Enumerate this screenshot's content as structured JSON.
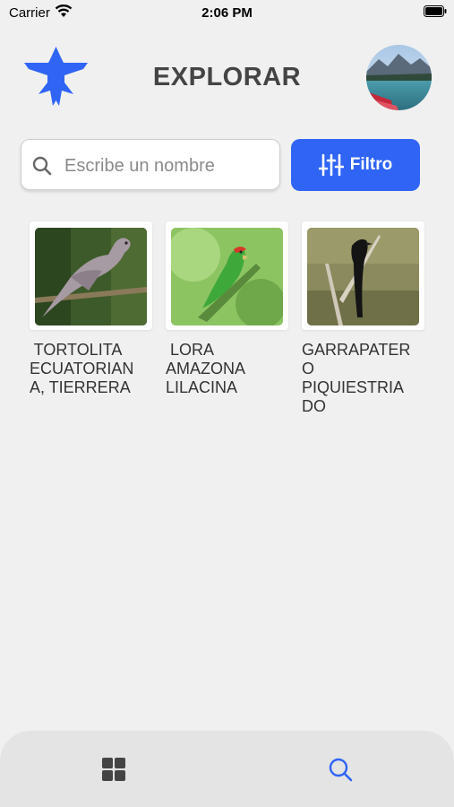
{
  "status_bar": {
    "carrier": "Carrier",
    "time": "2:06 PM"
  },
  "header": {
    "title": "EXPLORAR",
    "logo_icon": "bird-logo-icon",
    "avatar_icon": "lake-mountain-avatar"
  },
  "search": {
    "placeholder": "Escribe un nombre",
    "value": ""
  },
  "filter": {
    "label": "Filtro",
    "icon": "sliders-icon"
  },
  "birds": [
    {
      "name": " TORTOLITA\nECUATORIAN\nA, TIERRERA",
      "photo": "dove-photo"
    },
    {
      "name": " LORA\nAMAZONA\nLILACINA",
      "photo": "green-parrot-photo"
    },
    {
      "name": "GARRAPATER\nO\nPIQUIESTRIA\nDO",
      "photo": "black-bird-photo"
    }
  ],
  "tab_bar": {
    "tabs": [
      {
        "icon": "grid-icon",
        "active": false
      },
      {
        "icon": "search-icon",
        "active": true
      }
    ]
  },
  "colors": {
    "accent": "#2f64f5",
    "background": "#f0f0f0",
    "text": "#333333"
  }
}
